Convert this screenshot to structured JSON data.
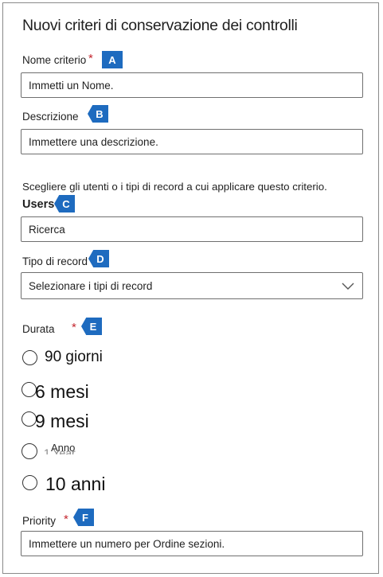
{
  "form": {
    "title": "Nuovi criteri di conservazione dei controlli",
    "required_mark": "*",
    "name": {
      "label": "Nome criterio",
      "placeholder": "Immetti un Nome.",
      "badge": "A"
    },
    "description": {
      "label": "Descrizione",
      "placeholder": "Immettere una descrizione.",
      "badge": "B"
    },
    "scope_instruction": "Scegliere gli utenti o i tipi di record a cui applicare questo criterio.",
    "users": {
      "label": "Users",
      "placeholder": "Ricerca",
      "badge": "C"
    },
    "record_type": {
      "label": "Tipo di record",
      "selected": "Selezionare i tipi di record",
      "badge": "D",
      "icon": "chevron-down-icon"
    },
    "duration": {
      "label": "Durata",
      "badge": "E",
      "options": [
        {
          "label": "90 giorni"
        },
        {
          "label": "6 mesi"
        },
        {
          "label": "9 mesi"
        },
        {
          "label": "1 Year",
          "overlay": "Anno"
        },
        {
          "label": "10 anni"
        }
      ]
    },
    "priority": {
      "label": "Priority",
      "placeholder": "Immettere un numero per Ordine sezioni.",
      "badge": "F"
    }
  },
  "colors": {
    "badge": "#1e6bbf",
    "required": "#c4262e",
    "border": "#6f6f6f"
  }
}
